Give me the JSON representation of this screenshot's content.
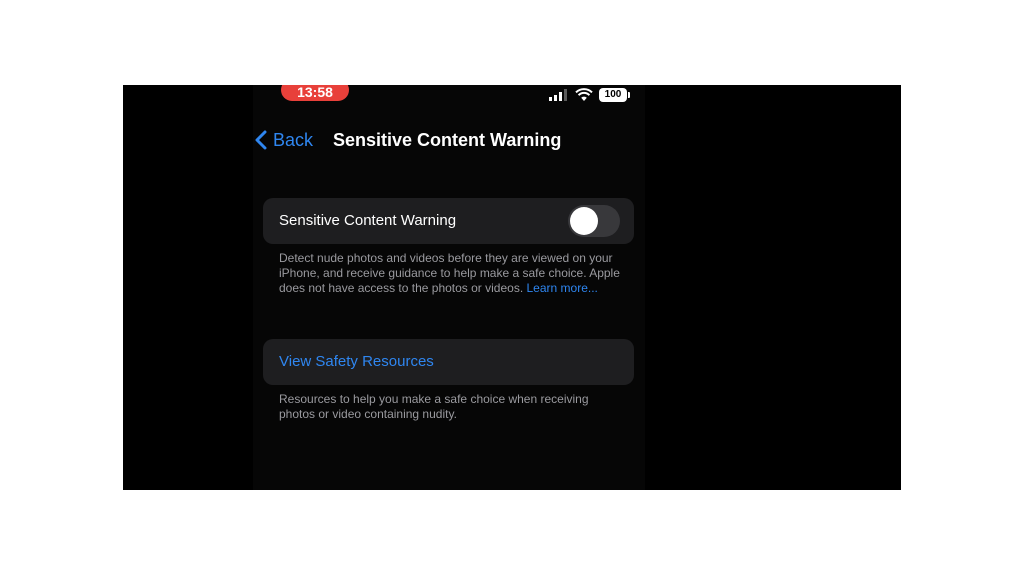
{
  "status_bar": {
    "time": "13:58",
    "battery": "100",
    "time_pill_color": "#e8403a"
  },
  "nav": {
    "back_label": "Back",
    "title": "Sensitive Content Warning"
  },
  "settings": {
    "toggle_row": {
      "label": "Sensitive Content Warning",
      "enabled": false
    },
    "toggle_footer": "Detect nude photos and videos before they are viewed on your iPhone, and receive guidance to help make a safe choice. Apple does not have access to the photos or videos.",
    "learn_more": "Learn more...",
    "resources_link": "View Safety Resources",
    "resources_footer": "Resources to help you make a safe choice when receiving photos or video containing nudity."
  },
  "colors": {
    "accent": "#2f86f0",
    "background": "#060606",
    "cell": "#1e1e20"
  }
}
